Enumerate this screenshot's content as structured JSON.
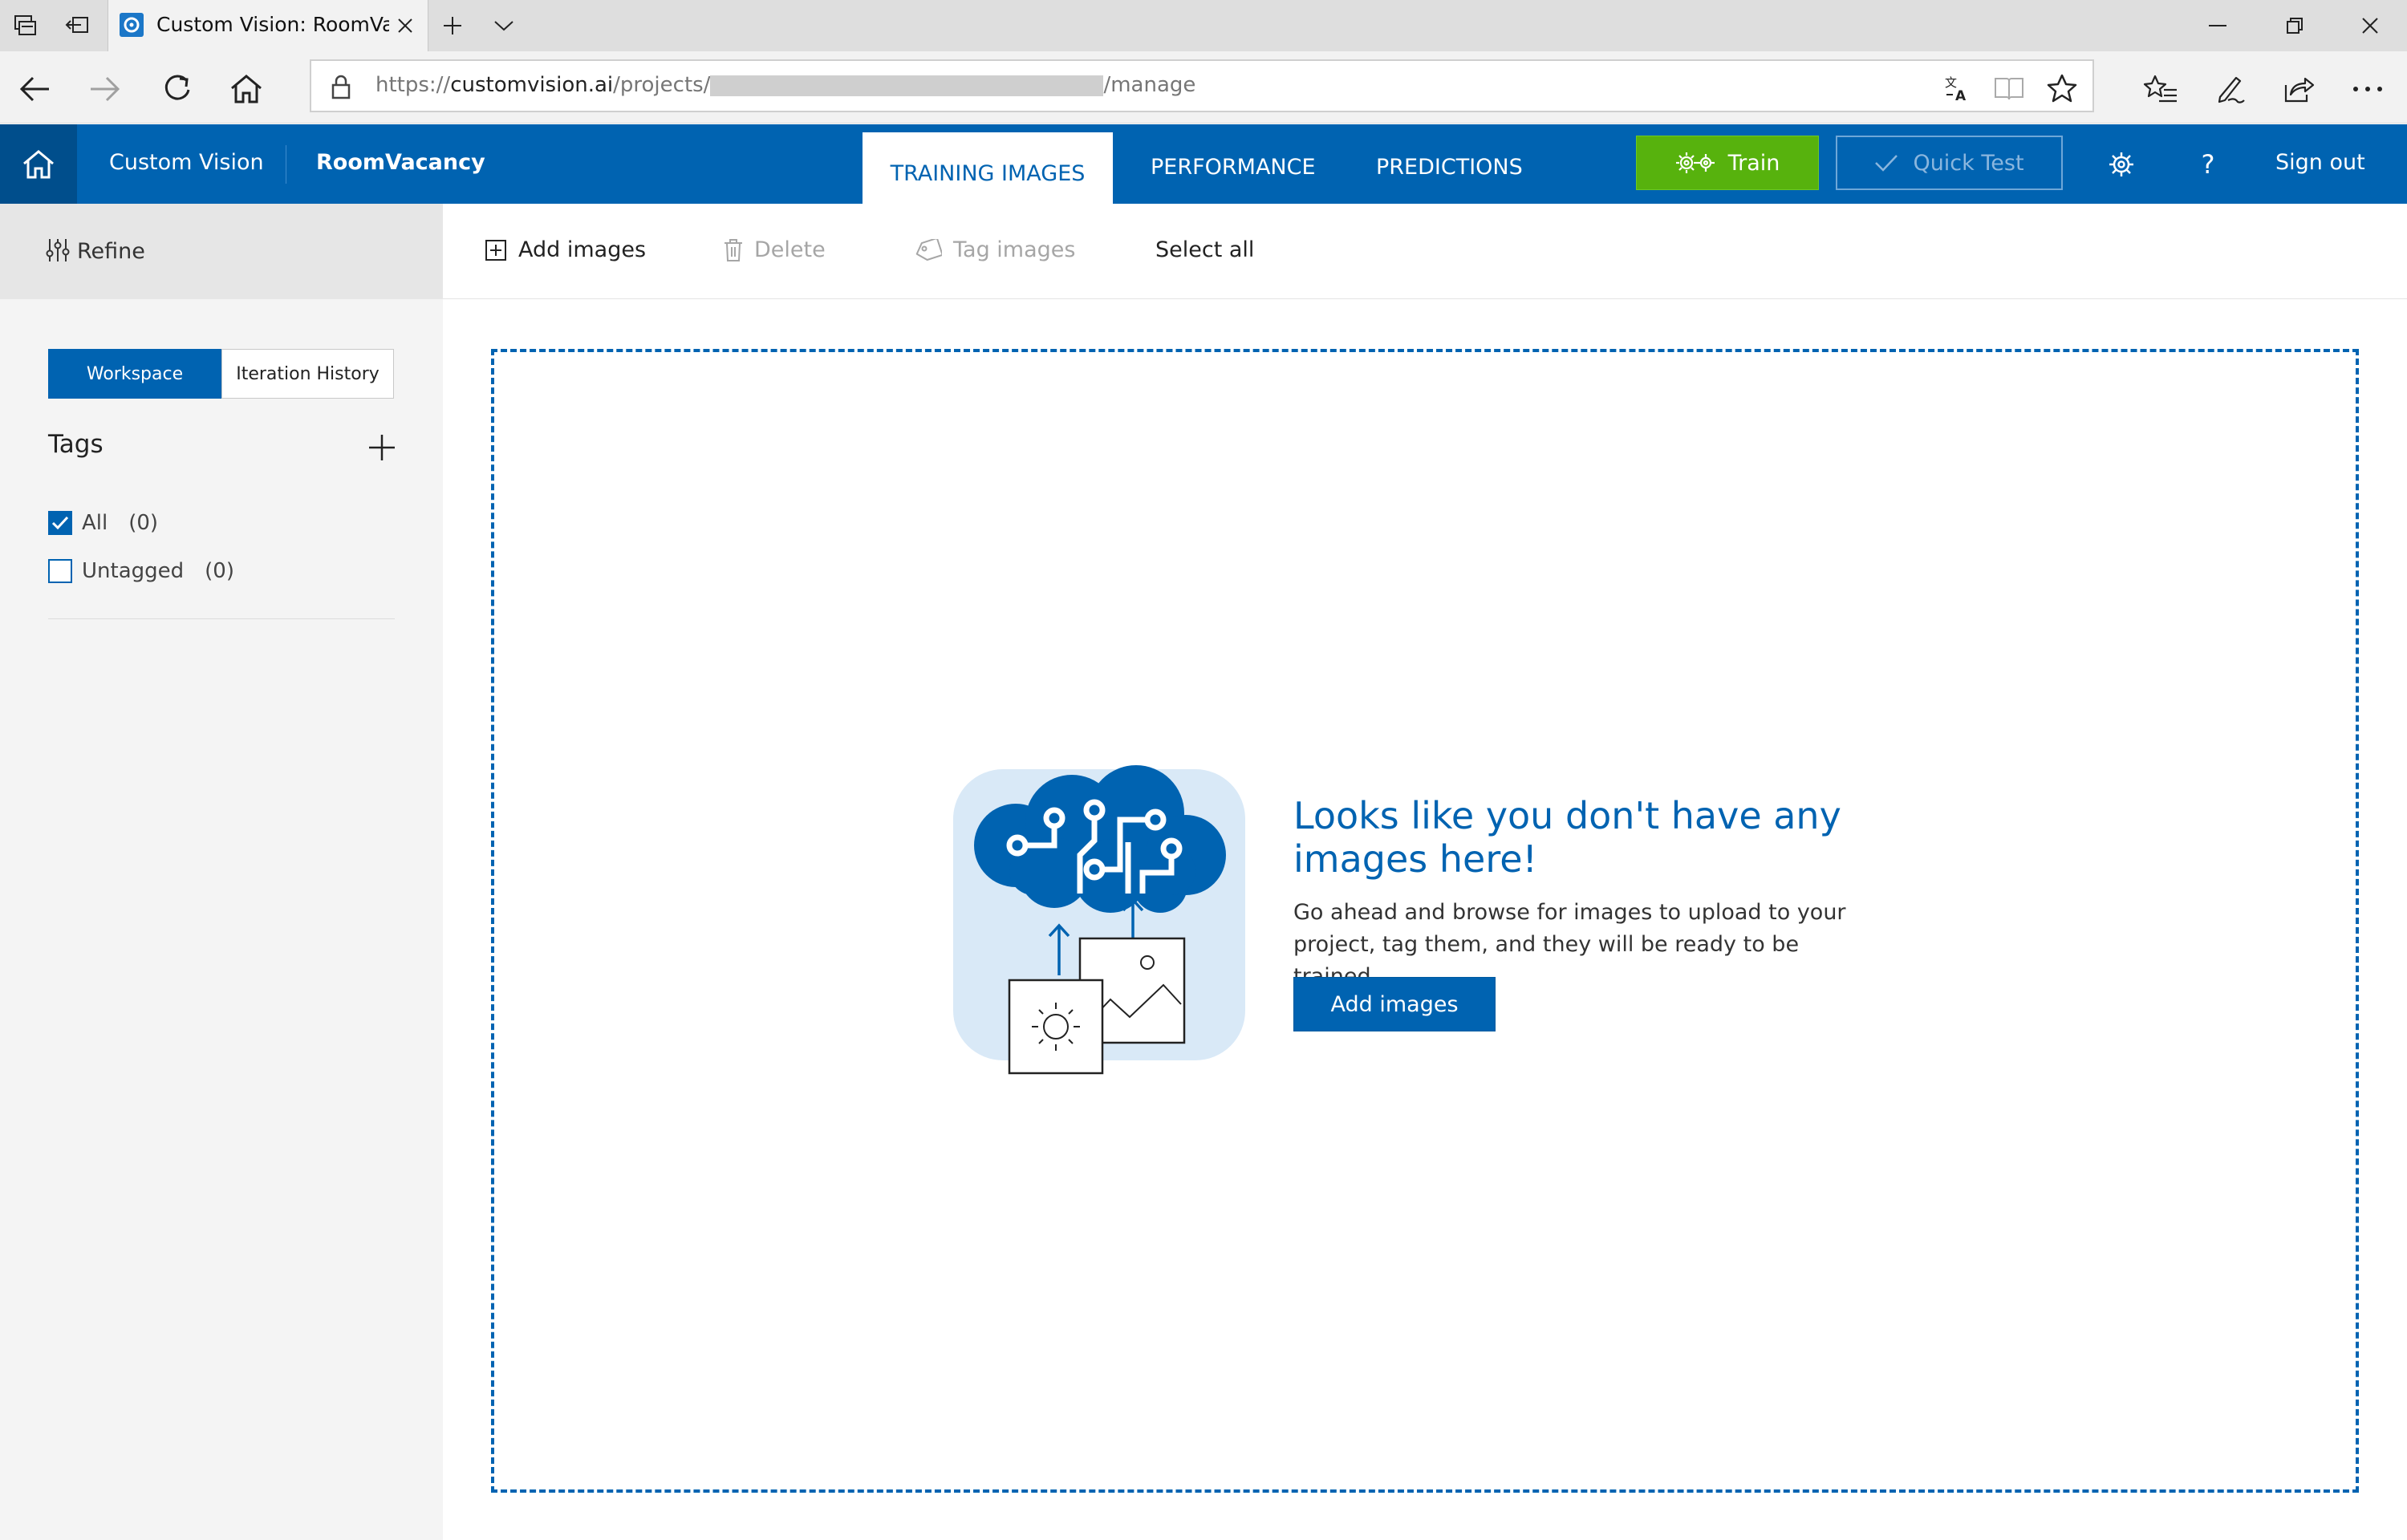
{
  "browser": {
    "tab_title": "Custom Vision: RoomVa",
    "url_scheme": "https://",
    "url_host": "customvision.ai",
    "url_path_start": "/projects/",
    "url_path_end": "/manage"
  },
  "header": {
    "app_name": "Custom Vision",
    "project_name": "RoomVacancy",
    "tabs": [
      {
        "label": "TRAINING IMAGES",
        "active": true
      },
      {
        "label": "PERFORMANCE",
        "active": false
      },
      {
        "label": "PREDICTIONS",
        "active": false
      }
    ],
    "train_label": "Train",
    "quick_test_label": "Quick Test",
    "help_label": "?",
    "sign_out_label": "Sign out",
    "accent_color": "#0063b1",
    "train_color": "#57b20d"
  },
  "sidebar": {
    "refine_label": "Refine",
    "workspace_label": "Workspace",
    "iteration_history_label": "Iteration History",
    "tags_title": "Tags",
    "tags": [
      {
        "name": "All",
        "count": "(0)",
        "checked": true
      },
      {
        "name": "Untagged",
        "count": "(0)",
        "checked": false
      }
    ]
  },
  "toolbar": {
    "add_images_label": "Add images",
    "delete_label": "Delete",
    "tag_images_label": "Tag images",
    "select_all_label": "Select all"
  },
  "empty_state": {
    "title": "Looks like you don't have any images here!",
    "description": "Go ahead and browse for images to upload to your project, tag them, and they will be ready to be trained.",
    "button_label": "Add images"
  },
  "icons": {
    "tab_strip": [
      "tab-list-icon",
      "set-aside-tabs-icon",
      "new-tab-icon",
      "tab-dropdown-icon"
    ],
    "window": [
      "minimize-icon",
      "restore-icon",
      "close-icon"
    ],
    "nav": [
      "back-icon",
      "forward-icon",
      "refresh-icon",
      "home-icon"
    ],
    "address_bar": [
      "lock-icon",
      "translate-icon",
      "reading-view-icon",
      "favorite-star-icon"
    ],
    "browser_tools": [
      "favorites-list-icon",
      "notes-pen-icon",
      "share-icon",
      "more-icon"
    ],
    "app": [
      "app-home-icon",
      "gears-icon",
      "checkmark-icon",
      "settings-gear-icon",
      "help-icon"
    ],
    "sidebar": [
      "sliders-icon",
      "plus-icon",
      "checkbox-checked-icon",
      "checkbox-empty-icon"
    ],
    "toolbar": [
      "add-image-icon",
      "trash-icon",
      "tag-icon"
    ],
    "empty_state": [
      "cloud-brain-upload-illustration"
    ]
  }
}
